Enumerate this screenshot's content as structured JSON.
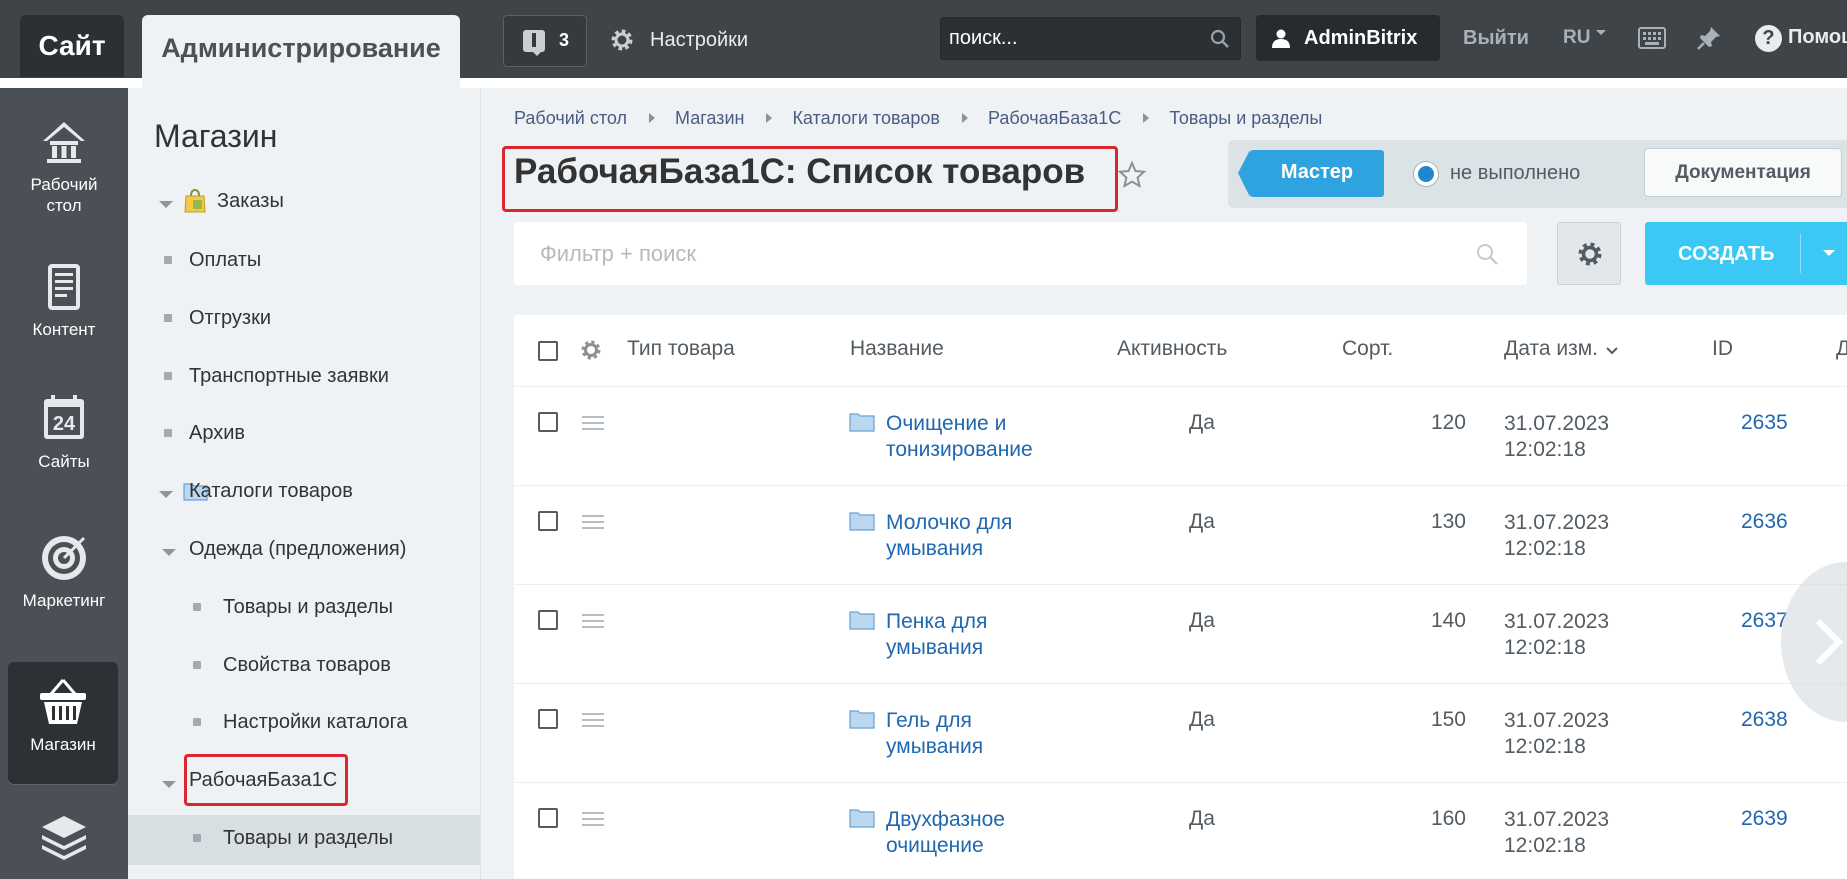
{
  "topbar": {
    "site_label": "Сайт",
    "admin_tab": "Администрирование",
    "notifications_count": "3",
    "settings_label": "Настройки",
    "search_placeholder": "поиск...",
    "user_name": "AdminBitrix",
    "logout_label": "Выйти",
    "lang": "RU",
    "help_label": "Помощь"
  },
  "leftnav": {
    "items": [
      {
        "label_line1": "Рабочий",
        "label_line2": "стол",
        "icon": "home-icon"
      },
      {
        "label_line1": "Контент",
        "label_line2": "",
        "icon": "document-icon"
      },
      {
        "label_line1": "Сайты",
        "label_line2": "",
        "icon": "calendar-24-icon"
      },
      {
        "label_line1": "Маркетинг",
        "label_line2": "",
        "icon": "target-icon"
      },
      {
        "label_line1": "Магазин",
        "label_line2": "",
        "icon": "basket-icon",
        "active": true
      },
      {
        "label_line1": "",
        "label_line2": "",
        "icon": "layers-icon"
      }
    ]
  },
  "sidebar": {
    "title": "Магазин",
    "items": [
      {
        "label": "Заказы"
      },
      {
        "label": "Оплаты"
      },
      {
        "label": "Отгрузки"
      },
      {
        "label": "Транспортные заявки"
      },
      {
        "label": "Архив"
      },
      {
        "label": "Каталоги товаров"
      },
      {
        "label": "Одежда (предложения)"
      },
      {
        "label": "Товары и разделы"
      },
      {
        "label": "Свойства товаров"
      },
      {
        "label": "Настройки каталога"
      },
      {
        "label": "РабочаяБаза1С"
      },
      {
        "label": "Товары и разделы"
      }
    ]
  },
  "breadcrumbs": [
    "Рабочий стол",
    "Магазин",
    "Каталоги товаров",
    "РабочаяБаза1С",
    "Товары и разделы"
  ],
  "page": {
    "title": "РабочаяБаза1С: Список товаров",
    "master_label": "Мастер",
    "master_status": "не выполнено",
    "docs_label": "Документация",
    "filter_placeholder": "Фильтр + поиск",
    "create_label": "СОЗДАТЬ"
  },
  "table": {
    "columns": [
      "Тип товара",
      "Название",
      "Активность",
      "Сорт.",
      "Дата изм.",
      "ID",
      "Д"
    ],
    "rows": [
      {
        "name_line1": "Очищение и",
        "name_line2": "тонизирование",
        "active": "Да",
        "sort": "120",
        "date": "31.07.2023",
        "time": "12:02:18",
        "id": "2635"
      },
      {
        "name_line1": "Молочко для",
        "name_line2": "умывания",
        "active": "Да",
        "sort": "130",
        "date": "31.07.2023",
        "time": "12:02:18",
        "id": "2636"
      },
      {
        "name_line1": "Пенка для",
        "name_line2": "умывания",
        "active": "Да",
        "sort": "140",
        "date": "31.07.2023",
        "time": "12:02:18",
        "id": "2637"
      },
      {
        "name_line1": "Гель для",
        "name_line2": "умывания",
        "active": "Да",
        "sort": "150",
        "date": "31.07.2023",
        "time": "12:02:18",
        "id": "2638"
      },
      {
        "name_line1": "Двухфазное",
        "name_line2": "очищение",
        "active": "Да",
        "sort": "160",
        "date": "31.07.2023",
        "time": "12:02:18",
        "id": "2639"
      }
    ]
  },
  "colors": {
    "highlight": "#d9272d",
    "link": "#2067b0",
    "create": "#3bc8f5",
    "master": "#2fa3e0"
  }
}
